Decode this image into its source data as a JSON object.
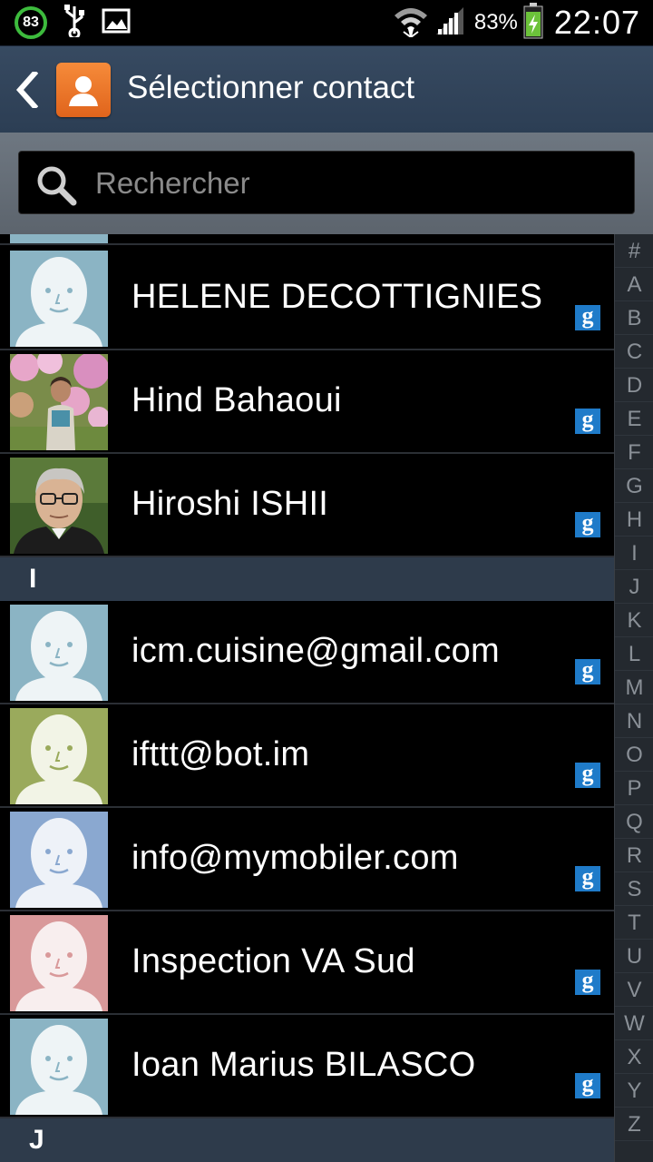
{
  "status_bar": {
    "notification_badge": "83",
    "icons_left": [
      "notification-count-icon",
      "usb-icon",
      "image-icon"
    ],
    "icons_right": [
      "wifi-icon",
      "signal-icon",
      "battery-charging-icon"
    ],
    "battery_percent": "83%",
    "time": "22:07"
  },
  "action_bar": {
    "back_icon": "back-arrow-icon",
    "app_icon": "contacts-app-icon",
    "title": "Sélectionner contact"
  },
  "search": {
    "placeholder": "Rechercher",
    "value": ""
  },
  "contacts": {
    "pre_items": [
      {
        "name": "HELENE DECOTTIGNIES",
        "avatar": "default-teal",
        "account": "google"
      },
      {
        "name": "Hind Bahaoui",
        "avatar": "photo-flowers",
        "account": "google"
      },
      {
        "name": "Hiroshi ISHII",
        "avatar": "photo-man-glasses",
        "account": "google"
      }
    ],
    "section_i": "I",
    "items_i": [
      {
        "name": "icm.cuisine@gmail.com",
        "avatar": "default-teal",
        "account": "google"
      },
      {
        "name": "ifttt@bot.im",
        "avatar": "default-olive",
        "account": "google"
      },
      {
        "name": "info@mymobiler.com",
        "avatar": "default-blue",
        "account": "google"
      },
      {
        "name": "Inspection VA Sud",
        "avatar": "default-pink",
        "account": "google"
      },
      {
        "name": "Ioan Marius BILASCO",
        "avatar": "default-teal",
        "account": "google"
      }
    ],
    "section_j": "J",
    "google_badge": "g"
  },
  "index_bar": [
    "#",
    "A",
    "B",
    "C",
    "D",
    "E",
    "F",
    "G",
    "H",
    "I",
    "J",
    "K",
    "L",
    "M",
    "N",
    "O",
    "P",
    "Q",
    "R",
    "S",
    "T",
    "U",
    "V",
    "W",
    "X",
    "Y",
    "Z"
  ],
  "colors": {
    "action_bar": "#2f4258",
    "section_header": "#2e3b4b",
    "google_badge": "#1f7bc9",
    "avatar_teal": "#8bb4c4",
    "avatar_olive": "#9aaa5c",
    "avatar_blue": "#8aa8d0",
    "avatar_pink": "#d9999a"
  }
}
